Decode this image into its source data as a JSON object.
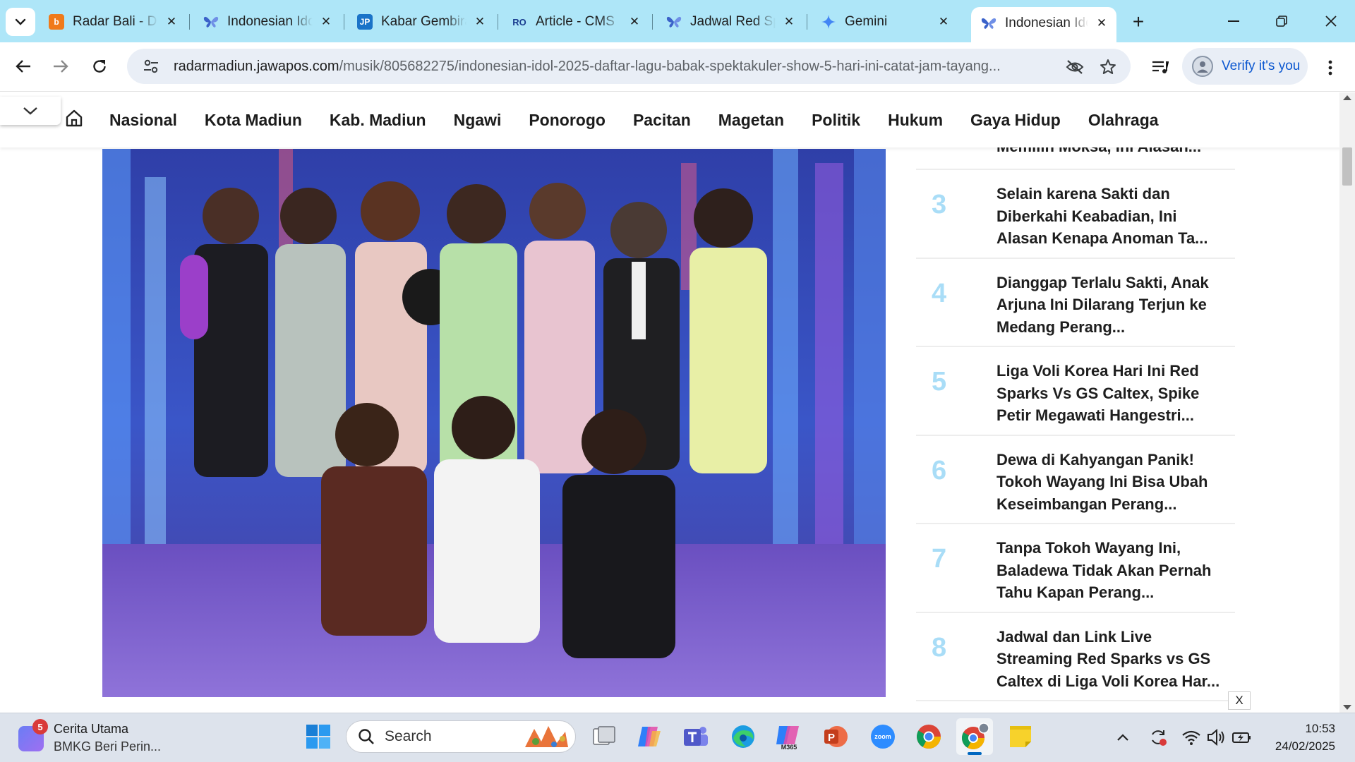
{
  "browser": {
    "tabs": [
      {
        "title": "Radar Bali - D",
        "favicon": "radarbali-icon",
        "color": "#f07a1a",
        "letter": "b"
      },
      {
        "title": "Indonesian Ido",
        "favicon": "butterfly-icon",
        "color": "#4a6fd1",
        "letter": ""
      },
      {
        "title": "Kabar Gembira",
        "favicon": "jp-icon",
        "color": "#1a73c8",
        "letter": "JP"
      },
      {
        "title": "Article - CMS",
        "favicon": "ro-icon",
        "color": "#ffffff",
        "letter": "RO"
      },
      {
        "title": "Jadwal Red Sp",
        "favicon": "butterfly-icon",
        "color": "#4a6fd1",
        "letter": ""
      },
      {
        "title": "Gemini",
        "favicon": "gemini-icon",
        "color": "#4285f4",
        "letter": ""
      },
      {
        "title": "Indonesian Ido",
        "favicon": "butterfly-icon",
        "color": "#4a6fd1",
        "letter": "",
        "active": true
      }
    ],
    "url_host": "radarmadiun.jawapos.com",
    "url_path": "/musik/805682275/indonesian-idol-2025-daftar-lagu-babak-spektakuler-show-5-hari-ini-catat-jam-tayang...",
    "verify_label": "Verify it's you"
  },
  "site": {
    "nav": [
      "Nasional",
      "Kota Madiun",
      "Kab. Madiun",
      "Ngawi",
      "Ponorogo",
      "Pacitan",
      "Magetan",
      "Politik",
      "Hukum",
      "Gaya Hidup",
      "Olahraga"
    ]
  },
  "sidebar": {
    "partial_title": "Memilih Moksa, Ini Alasan...",
    "items": [
      {
        "num": "3",
        "title": "Selain karena Sakti dan Diberkahi Keabadian, Ini Alasan Kenapa Anoman Ta..."
      },
      {
        "num": "4",
        "title": "Dianggap Terlalu Sakti, Anak Arjuna Ini Dilarang Terjun ke Medang Perang..."
      },
      {
        "num": "5",
        "title": "Liga Voli Korea Hari Ini Red Sparks Vs GS Caltex, Spike Petir Megawati Hangestri..."
      },
      {
        "num": "6",
        "title": "Dewa di Kahyangan Panik! Tokoh Wayang Ini Bisa Ubah Keseimbangan Perang..."
      },
      {
        "num": "7",
        "title": "Tanpa Tokoh Wayang Ini, Baladewa Tidak Akan Pernah Tahu Kapan Perang..."
      },
      {
        "num": "8",
        "title": "Jadwal dan Link Live Streaming Red Sparks vs GS Caltex di Liga Voli Korea Har..."
      }
    ],
    "close_ad": "X"
  },
  "taskbar": {
    "news_title": "Cerita Utama",
    "news_sub": "BMKG Beri Perin...",
    "news_badge": "5",
    "search_label": "Search",
    "time": "10:53",
    "date": "24/02/2025",
    "zoom_label": "zoom",
    "m365_label": "M365",
    "colors": {
      "accent": "#0067c0",
      "tabstrip": "#aee6f8",
      "rank_number": "#a9ddf7"
    }
  }
}
